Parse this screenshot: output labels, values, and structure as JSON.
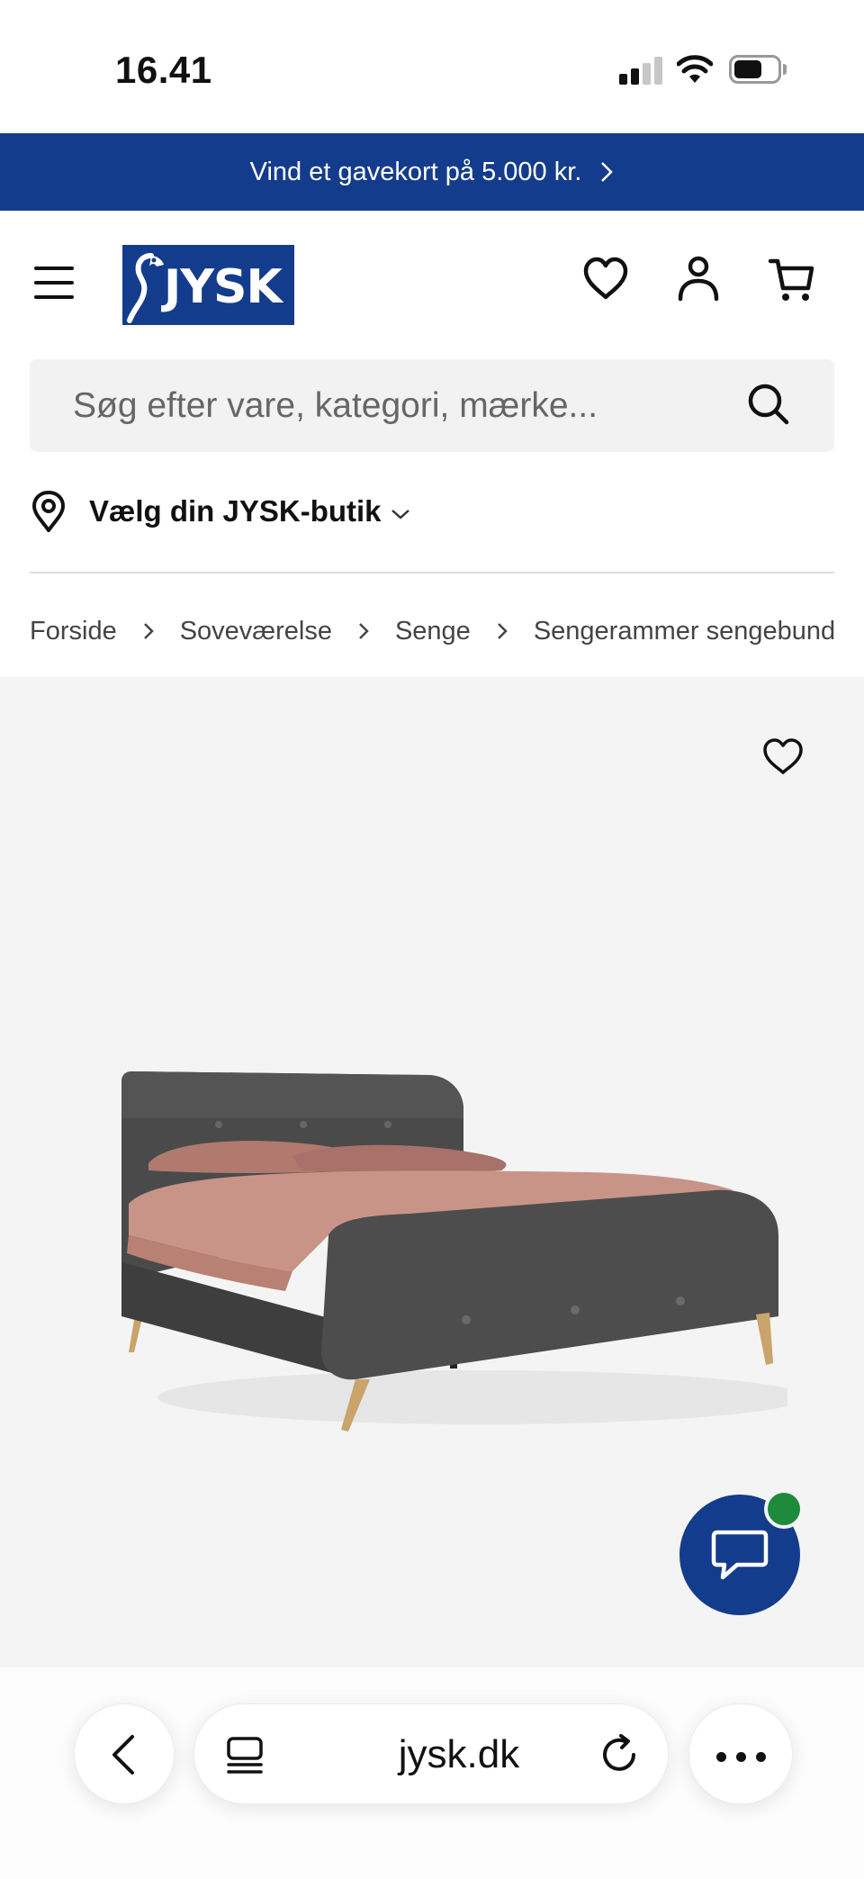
{
  "status_bar": {
    "time": "16.41",
    "signal_bars": 2,
    "battery_level": 0.55
  },
  "promo": {
    "text": "Vind et gavekort på 5.000 kr."
  },
  "header": {
    "logo_text": "JYSK",
    "icons": [
      "menu-icon",
      "heart-icon",
      "account-icon",
      "cart-icon"
    ]
  },
  "search": {
    "placeholder": "Søg efter vare, kategori, mærke..."
  },
  "store": {
    "label": "Vælg din JYSK-butik"
  },
  "breadcrumb": {
    "items": [
      "Forside",
      "Soveværelse",
      "Senge",
      "Sengerammer sengebunde og"
    ]
  },
  "browser": {
    "url": "jysk.dk"
  },
  "colors": {
    "brand_blue": "#143c8c",
    "online_green": "#1f8a3b",
    "gallery_bg": "#f4f4f4"
  }
}
